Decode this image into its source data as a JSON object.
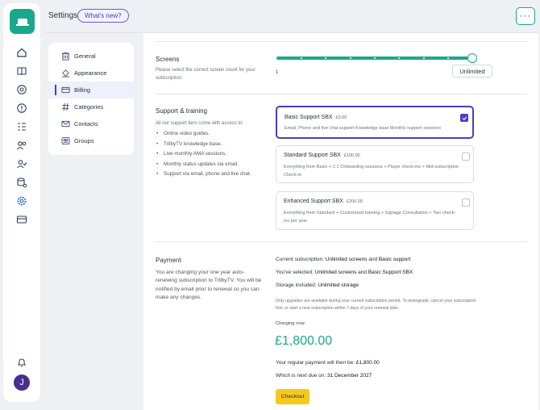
{
  "topbar": {
    "title": "Settings",
    "whats_new": "What's new?",
    "more": "···"
  },
  "nav": {
    "items": [
      {
        "label": "General",
        "icon": "building-icon"
      },
      {
        "label": "Appearance",
        "icon": "paint-bucket-icon"
      },
      {
        "label": "Billing",
        "icon": "credit-card-icon"
      },
      {
        "label": "Categories",
        "icon": "hashtag-icon"
      },
      {
        "label": "Contacts",
        "icon": "envelope-icon"
      },
      {
        "label": "Groups",
        "icon": "groups-icon"
      }
    ],
    "active": "Billing"
  },
  "screens": {
    "title": "Screens",
    "description": "Please select the correct screen count for your subscription.",
    "min_label": "1",
    "value": "Unlimited",
    "slider_fraction": 1.0
  },
  "support": {
    "title": "Support & training",
    "intro": "All our support tiers come with access to:",
    "bullets": [
      "Online video guides.",
      "TrilbyTV knowledge base.",
      "Live monthly AMA sessions.",
      "Monthly status updates via email.",
      "Support via email, phone and live chat."
    ],
    "tiers": [
      {
        "name": "Basic Support SBX",
        "price": "£0.00",
        "description": "Email, Phone and live chat support Knowledge base Monthly support sessions",
        "checked": true
      },
      {
        "name": "Standard Support SBX",
        "price": "£100.00",
        "description": "Everything from Basic + 1:1 Onboarding sessions + Player check-ins + Mid-subscription Check-in",
        "checked": false
      },
      {
        "name": "Enhanced Support SBX",
        "price": "£200.00",
        "description": "Everything from Standard + Customised training + Signage Consultation + Two check-ins per year",
        "checked": false
      }
    ]
  },
  "payment": {
    "title": "Payment",
    "description": "You are changing your one year auto-renewing subscription to TrilbyTV. You will be notified by email prior to renewal so you can make any changes.",
    "current_prefix": "Current subscription: ",
    "current_screens": "Unlimited screens",
    "and": " and ",
    "current_support": "Basic support",
    "selected_prefix": "You've selected: ",
    "selected_screens": "Unlimited screens",
    "selected_support": "Basic Support SBX",
    "storage_prefix": "Storage included: ",
    "storage_value": "Unlimited storage",
    "note": "Only upgrades are available during your current subscription period. To downgrade, cancel your subscription first, or start a new subscription within 7 days of your renewal date.",
    "charging_label": "Charging now",
    "amount": "£1,800.00",
    "regular_prefix": "Your regular payment will then be: ",
    "regular_value": "£1,800.00",
    "due_prefix": "Which is next due on: ",
    "due_value": "31 December 2027",
    "checkout": "Checkout"
  },
  "user": {
    "initial": "J"
  },
  "colors": {
    "accent": "#1aa88c",
    "primary": "#4a3cc2",
    "checkout": "#f7c81c"
  }
}
